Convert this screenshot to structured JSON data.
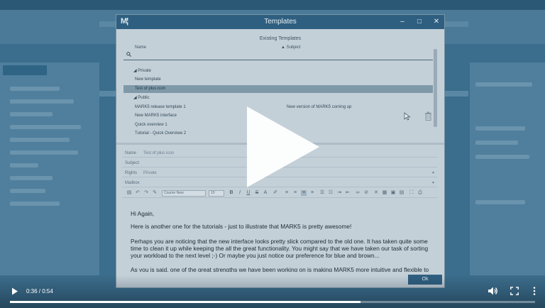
{
  "modal": {
    "logo": "M¦",
    "title": "Templates",
    "minimize": "–",
    "maximize": "□",
    "close": "✕"
  },
  "templates": {
    "header": "Existing Templates",
    "col_name": "Name",
    "col_subject": "▲ Subject",
    "rows": [
      {
        "kind": "group",
        "name": "◢ Private",
        "subject": ""
      },
      {
        "kind": "item",
        "name": "New template",
        "subject": ""
      },
      {
        "kind": "item",
        "name": "Test of plus icon",
        "subject": "",
        "selected": true
      },
      {
        "kind": "group",
        "name": "◢ Public",
        "subject": ""
      },
      {
        "kind": "item",
        "name": "MARK5 release template 1",
        "subject": "New version of MARK5 coming up"
      },
      {
        "kind": "item",
        "name": "New MARK5 interface",
        "subject": ""
      },
      {
        "kind": "item",
        "name": "Quick overview 1",
        "subject": ""
      },
      {
        "kind": "item",
        "name": "Tutorial - Quick Overview 2",
        "subject": ""
      }
    ]
  },
  "form": {
    "name_label": "Name",
    "name_value": "Test of plus icon",
    "subject_label": "Subject",
    "subject_value": "",
    "rights_label": "Rights",
    "rights_value": "Private",
    "mailbox_label": "Mailbox",
    "mailbox_value": ""
  },
  "toolbar": {
    "font_family": "Courier New",
    "font_size": "10"
  },
  "editor": {
    "line1": "Hi Again,",
    "line2": "Here is another one for the tutorials - just to illustrate that MARK5 is pretty awesome!",
    "line3": "Perhaps you are noticing that the new interface looks pretty slick compared to the old one. It has taken quite some time to clean it up while keeping the all the great functionality. You might say that we have taken our task of sorting your workload to the next level ;-) Or maybe you just notice our preference for blue and brown...",
    "line4": "As you is said, one of the great strengths we have been working on is making MARK5 more intuitive and flexible to use in your daily"
  },
  "ok_label": "Ok",
  "video": {
    "time": "0:36 / 0:54",
    "progress": 0.667
  },
  "colors": {
    "accent": "#2f5f80",
    "backdrop": "#3b6d8c"
  }
}
